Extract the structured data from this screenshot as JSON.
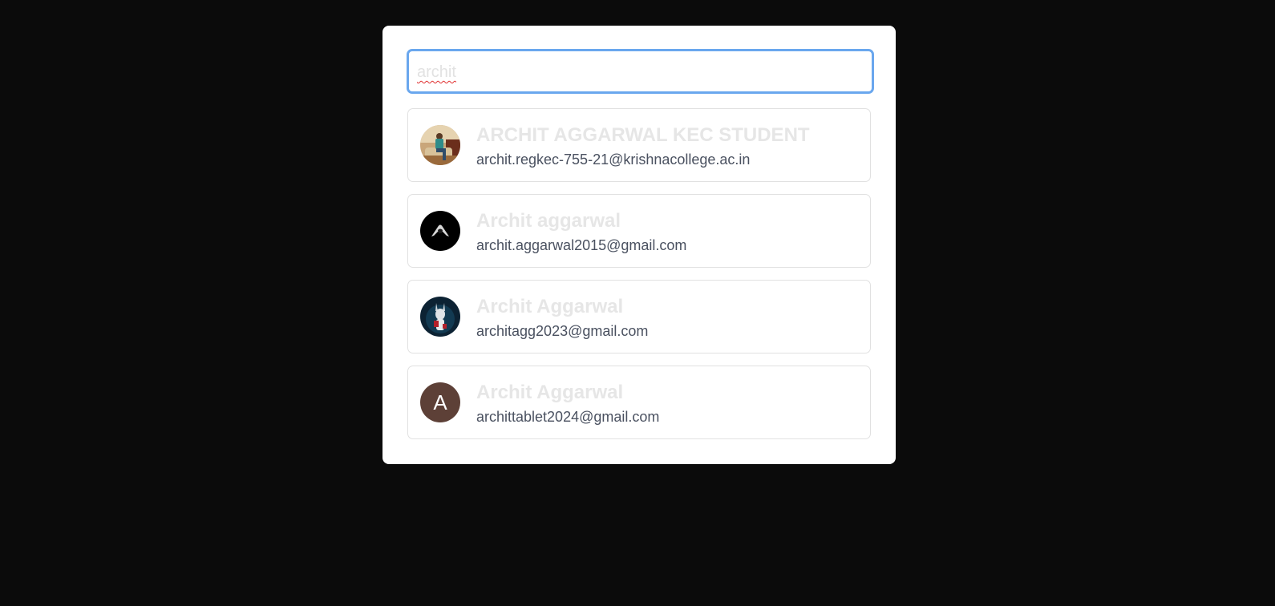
{
  "search": {
    "value": "archit",
    "placeholder": ""
  },
  "results": [
    {
      "name": "ARCHIT AGGARWAL KEC STUDENT",
      "email": "archit.regkec-755-21@krishnacollege.ac.in",
      "avatar": "photo-person-on-sofa"
    },
    {
      "name": "Archit aggarwal",
      "email": "archit.aggarwal2015@gmail.com",
      "avatar": "photo-dark-hooded-figure"
    },
    {
      "name": "Archit Aggarwal",
      "email": "architagg2023@gmail.com",
      "avatar": "photo-anime-character"
    },
    {
      "name": "Archit Aggarwal",
      "email": "archittablet2024@gmail.com",
      "avatar": "letter",
      "avatar_letter": "A",
      "avatar_color": "#5d4037"
    }
  ],
  "colors": {
    "page_background": "#0b0b0b",
    "focus_ring": "#6aa7ee",
    "name_text": "#e6e6e6",
    "email_text": "#4a5160"
  }
}
